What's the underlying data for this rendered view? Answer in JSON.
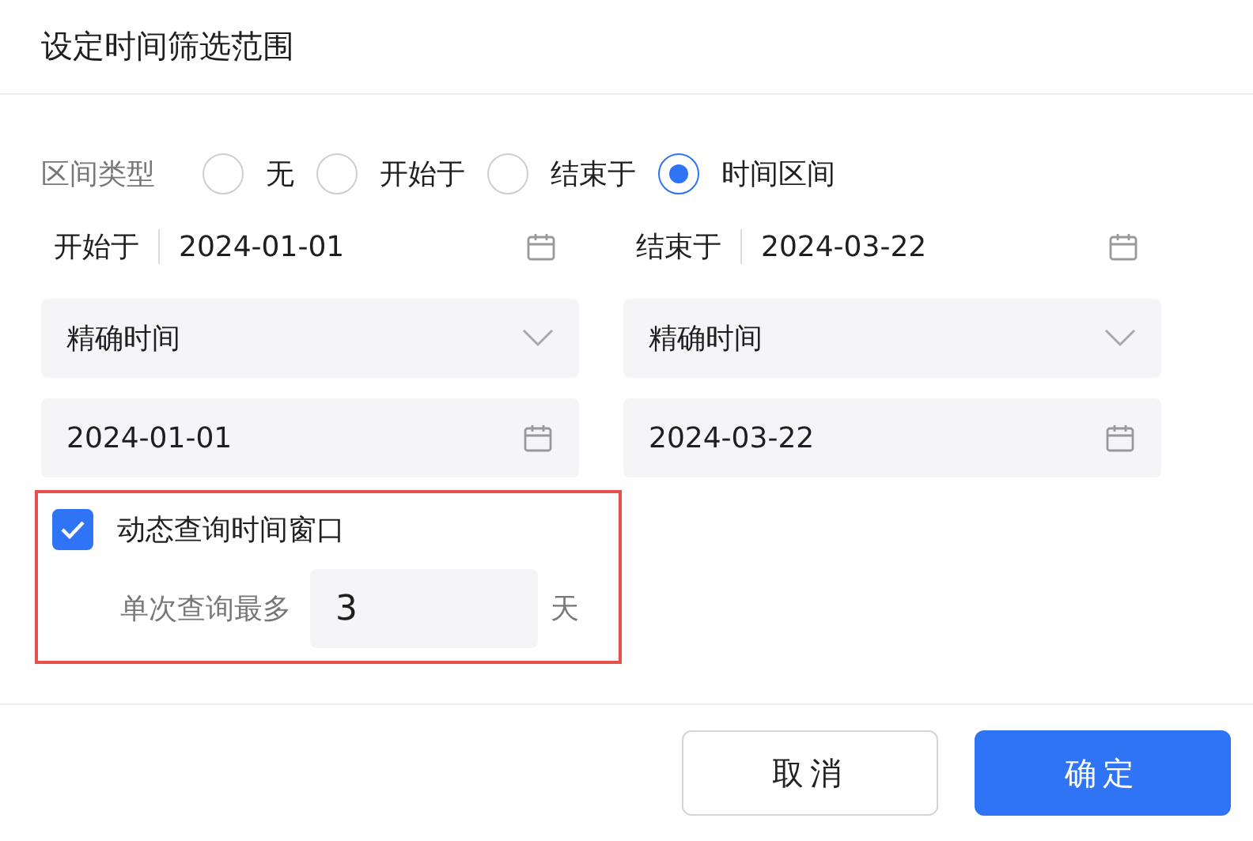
{
  "dialog": {
    "title": "设定时间筛选范围"
  },
  "range_type": {
    "label": "区间类型",
    "options": [
      {
        "label": "无",
        "selected": false
      },
      {
        "label": "开始于",
        "selected": false
      },
      {
        "label": "结束于",
        "selected": false
      },
      {
        "label": "时间区间",
        "selected": true
      }
    ]
  },
  "ranges": [
    {
      "label": "开始于",
      "value": "2024-01-01",
      "mode": "精确时间",
      "date": "2024-01-01"
    },
    {
      "label": "结束于",
      "value": "2024-03-22",
      "mode": "精确时间",
      "date": "2024-03-22"
    }
  ],
  "dynamic_window": {
    "checked": true,
    "highlighted": true,
    "label": "动态查询时间窗口",
    "max_label": "单次查询最多",
    "max_value": "3",
    "unit": "天"
  },
  "buttons": [
    {
      "label": "取消",
      "kind": "secondary"
    },
    {
      "label": "确定",
      "kind": "primary"
    }
  ]
}
